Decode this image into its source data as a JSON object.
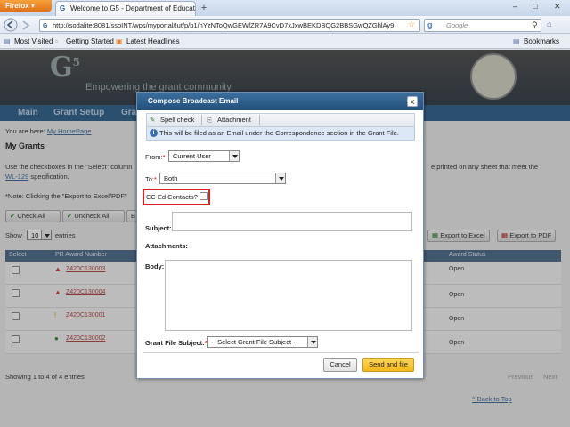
{
  "browser": {
    "app_button": "Firefox",
    "tab_title": "Welcome to G5 - Department of Educati...",
    "new_tab": "+",
    "url": "http://sodalite:8081/ssoINT/wps/myportal/!ut/p/b1/hYzNToQwGEWfZR7A9CvD7xJxwBEKDBQG2BBSGwQZGhlAy9",
    "search_placeholder": "Google",
    "bookmarks": [
      "Most Visited",
      "Getting Started",
      "Latest Headlines"
    ],
    "bookmarks_menu": "Bookmarks"
  },
  "page": {
    "logo": "G",
    "logo_sup": "5",
    "tagline": "Empowering the grant community",
    "nav": [
      "Main",
      "Grant Setup",
      "Gra"
    ],
    "breadcrumb_prefix": "You are here:",
    "breadcrumb_link": "My HomePage",
    "heading": "My Grants",
    "instr_left": "Use the checkboxes in the \"Select\" column",
    "instr_right": "e printed on any sheet that meet the",
    "wl_link": "WL-129",
    "wl_tail": "specification.",
    "note": "*Note: Clicking the \"Export to Excel/PDF\"",
    "check_all": "Check All",
    "uncheck_all": "Uncheck All",
    "partial_btn": "B",
    "show_label": "Show",
    "show_value": "10",
    "entries_label": "entries",
    "export_excel": "Export to Excel",
    "export_pdf": "Export to PDF",
    "columns": [
      "Select",
      "PR Award Number",
      "Award Status"
    ],
    "rows": [
      {
        "award": "Z420C130003",
        "status": "Open"
      },
      {
        "award": "Z420C130004",
        "status": "Open"
      },
      {
        "award": "Z420C130001",
        "status": "Open"
      },
      {
        "award": "Z420C130002",
        "status": "Open"
      }
    ],
    "showing": "Showing 1 to 4 of 4 entries",
    "prev": "Previous",
    "next": "Next",
    "back_to_top": "^ Back to Top"
  },
  "dialog": {
    "title": "Compose Broadcast Email",
    "close": "x",
    "spell_check": "Spell check",
    "attachment": "Attachment",
    "info": "This will be filed as an Email under the Correspondence section in the Grant File.",
    "from_label": "From:",
    "from_value": "Current User",
    "to_label": "To:",
    "to_value": "Both",
    "cc_label": "CC Ed Contacts?",
    "subject_label": "Subject:",
    "attachments_label": "Attachments:",
    "body_label": "Body:",
    "gfs_label": "Grant File Subject:",
    "gfs_value": "-- Select Grant File Subject --",
    "cancel": "Cancel",
    "send": "Send and file",
    "required_mark": "*"
  },
  "colors": {
    "dialog_title_bg": "#2c5d8c",
    "highlight": "#e02020",
    "send_button": "#f6c12f",
    "nav_bg": "#2d5f8a"
  }
}
